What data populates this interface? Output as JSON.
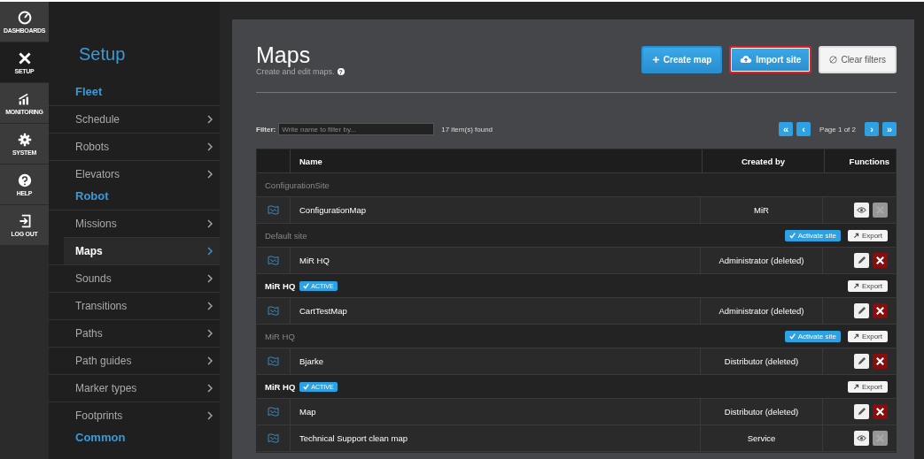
{
  "rail": [
    {
      "label": "DASHBOARDS",
      "selected": false
    },
    {
      "label": "SETUP",
      "selected": true
    },
    {
      "label": "MONITORING",
      "selected": false
    },
    {
      "label": "SYSTEM",
      "selected": false
    },
    {
      "label": "HELP",
      "selected": false
    },
    {
      "label": "LOG OUT",
      "selected": false
    }
  ],
  "sidebar": {
    "title": "Setup",
    "sections": [
      {
        "heading": "Fleet",
        "items": [
          {
            "label": "Schedule",
            "selected": false
          },
          {
            "label": "Robots",
            "selected": false
          },
          {
            "label": "Elevators",
            "selected": false
          }
        ]
      },
      {
        "heading": "Robot",
        "items": [
          {
            "label": "Missions",
            "selected": false
          },
          {
            "label": "Maps",
            "selected": true
          },
          {
            "label": "Sounds",
            "selected": false
          },
          {
            "label": "Transitions",
            "selected": false
          },
          {
            "label": "Paths",
            "selected": false
          },
          {
            "label": "Path guides",
            "selected": false
          },
          {
            "label": "Marker types",
            "selected": false
          },
          {
            "label": "Footprints",
            "selected": false
          }
        ]
      },
      {
        "heading": "Common"
      }
    ]
  },
  "page": {
    "title": "Maps",
    "subtitle": "Create and edit maps.",
    "help_icon": "?"
  },
  "buttons": [
    {
      "label": "Create map",
      "kind": "primary",
      "highlighted": false
    },
    {
      "label": "Import site",
      "kind": "primary",
      "highlighted": true
    },
    {
      "label": "Clear filters",
      "kind": "secondary",
      "highlighted": false
    }
  ],
  "filter": {
    "label": "Filter:",
    "placeholder": "Write name to filter by...",
    "count": "17 item(s) found"
  },
  "pagination": {
    "first": "«",
    "prev": "‹",
    "text": "Page 1 of 2",
    "next": "›",
    "last": "»"
  },
  "table": {
    "columns": [
      "Name",
      "Created by",
      "Functions"
    ],
    "rows": [
      {
        "kind": "site",
        "name": "ConfigurationSite",
        "active": false,
        "activate": null,
        "export": null
      },
      {
        "kind": "map",
        "name": "ConfigurationMap",
        "created_by": "MiR",
        "editable": false
      },
      {
        "kind": "site",
        "name": "Default site",
        "active": false,
        "activate": "Activate site",
        "export": "Export"
      },
      {
        "kind": "map",
        "name": "MiR HQ",
        "created_by": "Administrator (deleted)",
        "editable": true
      },
      {
        "kind": "site",
        "name": "MiR HQ",
        "active": true,
        "badge": "ACTIVE",
        "activate": null,
        "export": "Export"
      },
      {
        "kind": "map",
        "name": "CartTestMap",
        "created_by": "Administrator (deleted)",
        "editable": true
      },
      {
        "kind": "site",
        "name": "MiR HQ",
        "active": false,
        "activate": "Activate site",
        "export": "Export"
      },
      {
        "kind": "map",
        "name": "Bjarke",
        "created_by": "Distributor (deleted)",
        "editable": true
      },
      {
        "kind": "site",
        "name": "MiR HQ",
        "active": true,
        "badge": "ACTIVE",
        "activate": null,
        "export": "Export"
      },
      {
        "kind": "map",
        "name": "Map",
        "created_by": "Distributor (deleted)",
        "editable": true
      },
      {
        "kind": "map",
        "name": "Technical Support clean map",
        "created_by": "Service",
        "editable": false
      }
    ]
  }
}
